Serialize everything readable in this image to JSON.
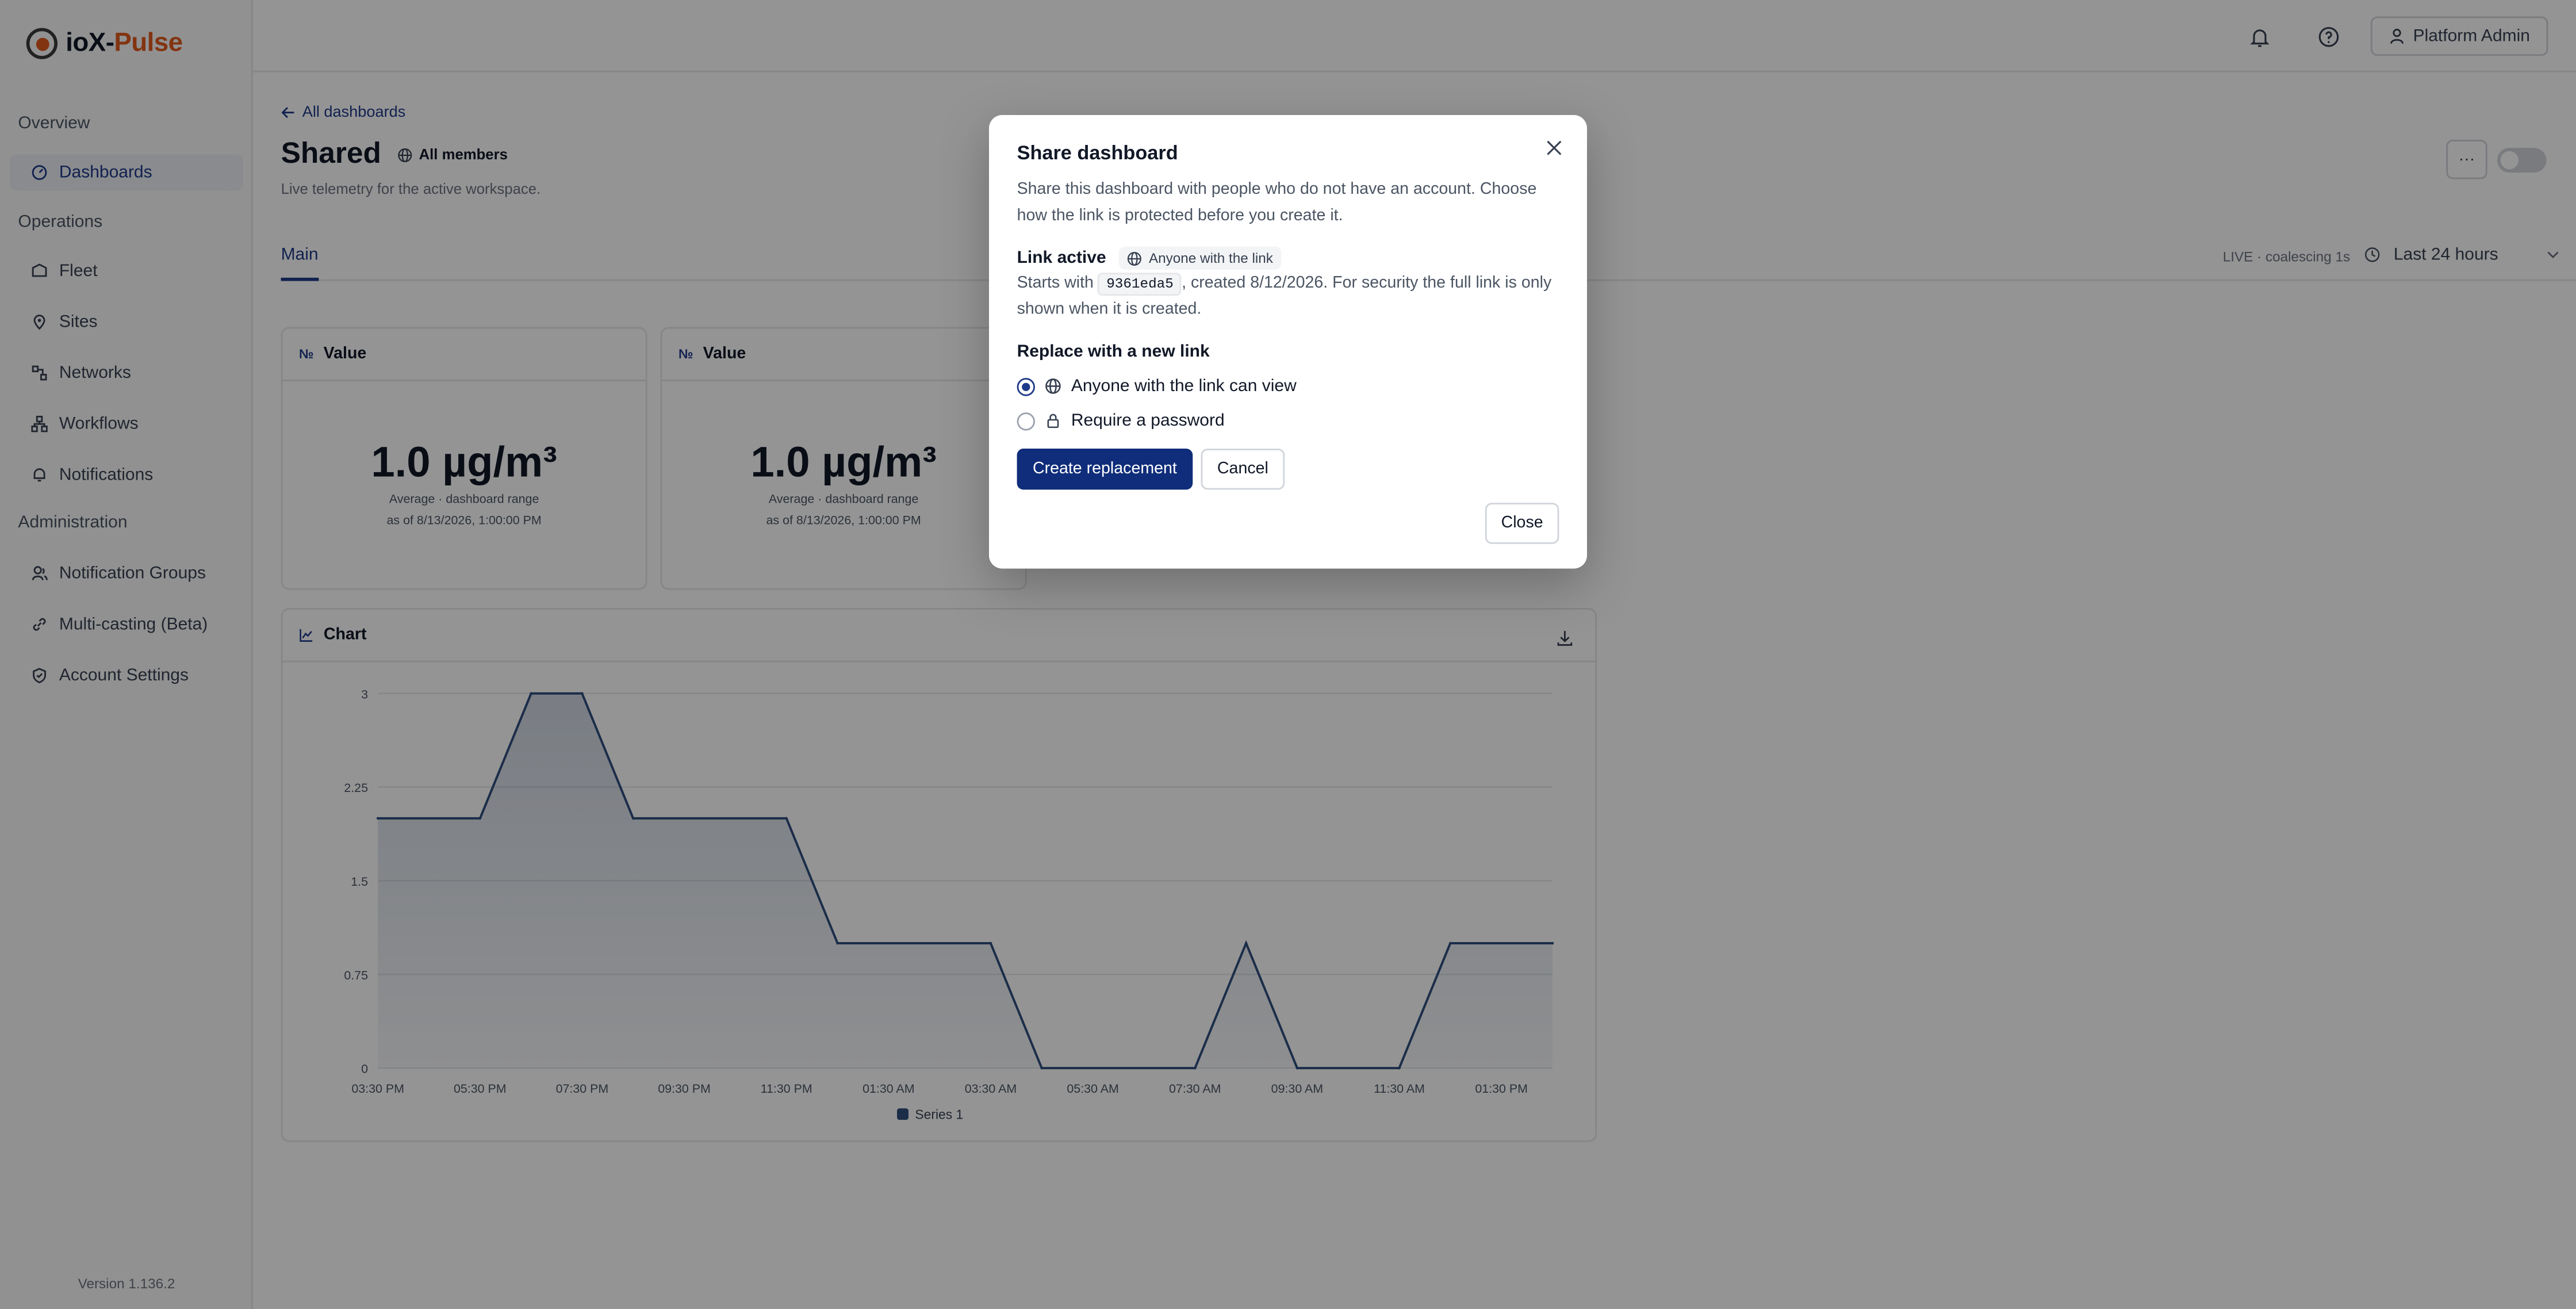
{
  "brand": {
    "name_a": "ioX-",
    "name_b": "Pulse"
  },
  "sidebar": {
    "sections": [
      {
        "label": "Overview"
      },
      {
        "label": "Operations"
      },
      {
        "label": "Administration"
      }
    ],
    "items": [
      {
        "label": "Dashboards",
        "icon": "gauge-icon"
      },
      {
        "label": "Fleet",
        "icon": "fleet-icon"
      },
      {
        "label": "Sites",
        "icon": "map-pin-icon"
      },
      {
        "label": "Networks",
        "icon": "network-icon"
      },
      {
        "label": "Workflows",
        "icon": "workflow-icon"
      },
      {
        "label": "Notifications",
        "icon": "bell-icon"
      },
      {
        "label": "Notification Groups",
        "icon": "users-icon"
      },
      {
        "label": "Multi-casting (Beta)",
        "icon": "link-icon"
      },
      {
        "label": "Account Settings",
        "icon": "shield-icon"
      }
    ],
    "version": "Version 1.136.2"
  },
  "topbar": {
    "user": "Platform Admin"
  },
  "page": {
    "back": "All dashboards",
    "title": "Shared",
    "scope": "All members",
    "subtitle": "Live telemetry for the active workspace.",
    "more": "···",
    "tab": "Main",
    "live": "LIVE · coalescing 1s",
    "range": "Last 24 hours"
  },
  "cards": [
    {
      "title": "Value",
      "glyph": "№",
      "value": "1.0 µg/m³",
      "caption": "Average · dashboard range",
      "asof": "as of 8/13/2026, 1:00:00 PM"
    },
    {
      "title": "Value",
      "glyph": "№",
      "value": "1.0 µg/m³",
      "caption": "Average · dashboard range",
      "asof": "as of 8/13/2026, 1:00:00 PM"
    }
  ],
  "chart_card": {
    "title": "Chart"
  },
  "chart_data": {
    "type": "area",
    "title": "Chart",
    "x": [
      "03:30 PM",
      "05:30 PM",
      "07:30 PM",
      "09:30 PM",
      "11:30 PM",
      "01:30 AM",
      "03:30 AM",
      "05:30 AM",
      "07:30 AM",
      "09:30 AM",
      "11:30 AM",
      "01:30 PM"
    ],
    "y_ticks": [
      "0",
      "0.75",
      "1.5",
      "2.25",
      "3"
    ],
    "ylim": [
      0,
      3
    ],
    "points": [
      {
        "h": 0,
        "v": 2
      },
      {
        "h": 2,
        "v": 2
      },
      {
        "h": 3,
        "v": 3
      },
      {
        "h": 4,
        "v": 3
      },
      {
        "h": 5,
        "v": 2
      },
      {
        "h": 8,
        "v": 2
      },
      {
        "h": 9,
        "v": 1
      },
      {
        "h": 12,
        "v": 1
      },
      {
        "h": 13,
        "v": 0
      },
      {
        "h": 16,
        "v": 0
      },
      {
        "h": 17,
        "v": 1
      },
      {
        "h": 18,
        "v": 0
      },
      {
        "h": 20,
        "v": 0
      },
      {
        "h": 21,
        "v": 1
      },
      {
        "h": 23,
        "v": 1
      }
    ],
    "series": [
      {
        "name": "Series 1",
        "color": "#2f4f7f"
      }
    ],
    "grid": true,
    "legend": "bottom"
  },
  "modal": {
    "title": "Share dashboard",
    "description": "Share this dashboard with people who do not have an account. Choose how the link is protected before you create it.",
    "link_title": "Link active",
    "link_scope": "Anyone with the link",
    "link_prefix": "Starts with",
    "link_code": "9361eda5",
    "link_rest": ", created 8/12/2026. For security the full link is only shown when it is created.",
    "replace_title": "Replace with a new link",
    "options": [
      {
        "label": "Anyone with the link can view",
        "selected": true
      },
      {
        "label": "Require a password",
        "selected": false
      }
    ],
    "create_label": "Create replacement",
    "cancel_label": "Cancel",
    "close_label": "Close"
  }
}
